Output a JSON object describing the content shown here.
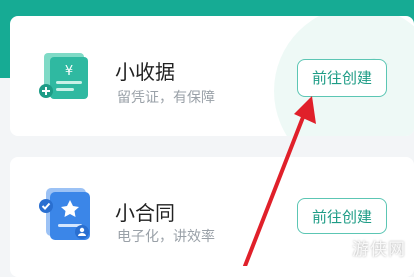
{
  "cards": [
    {
      "title": "小收据",
      "subtitle": "留凭证，有保障",
      "cta_label": "前往创建",
      "icon": "receipt-icon"
    },
    {
      "title": "小合同",
      "subtitle": "电子化，讲效率",
      "cta_label": "前往创建",
      "icon": "contract-icon"
    }
  ],
  "watermark": "游侠网",
  "colors": {
    "header": "#16ab94",
    "accent": "#1e9c86",
    "arrow": "#e0202a"
  }
}
